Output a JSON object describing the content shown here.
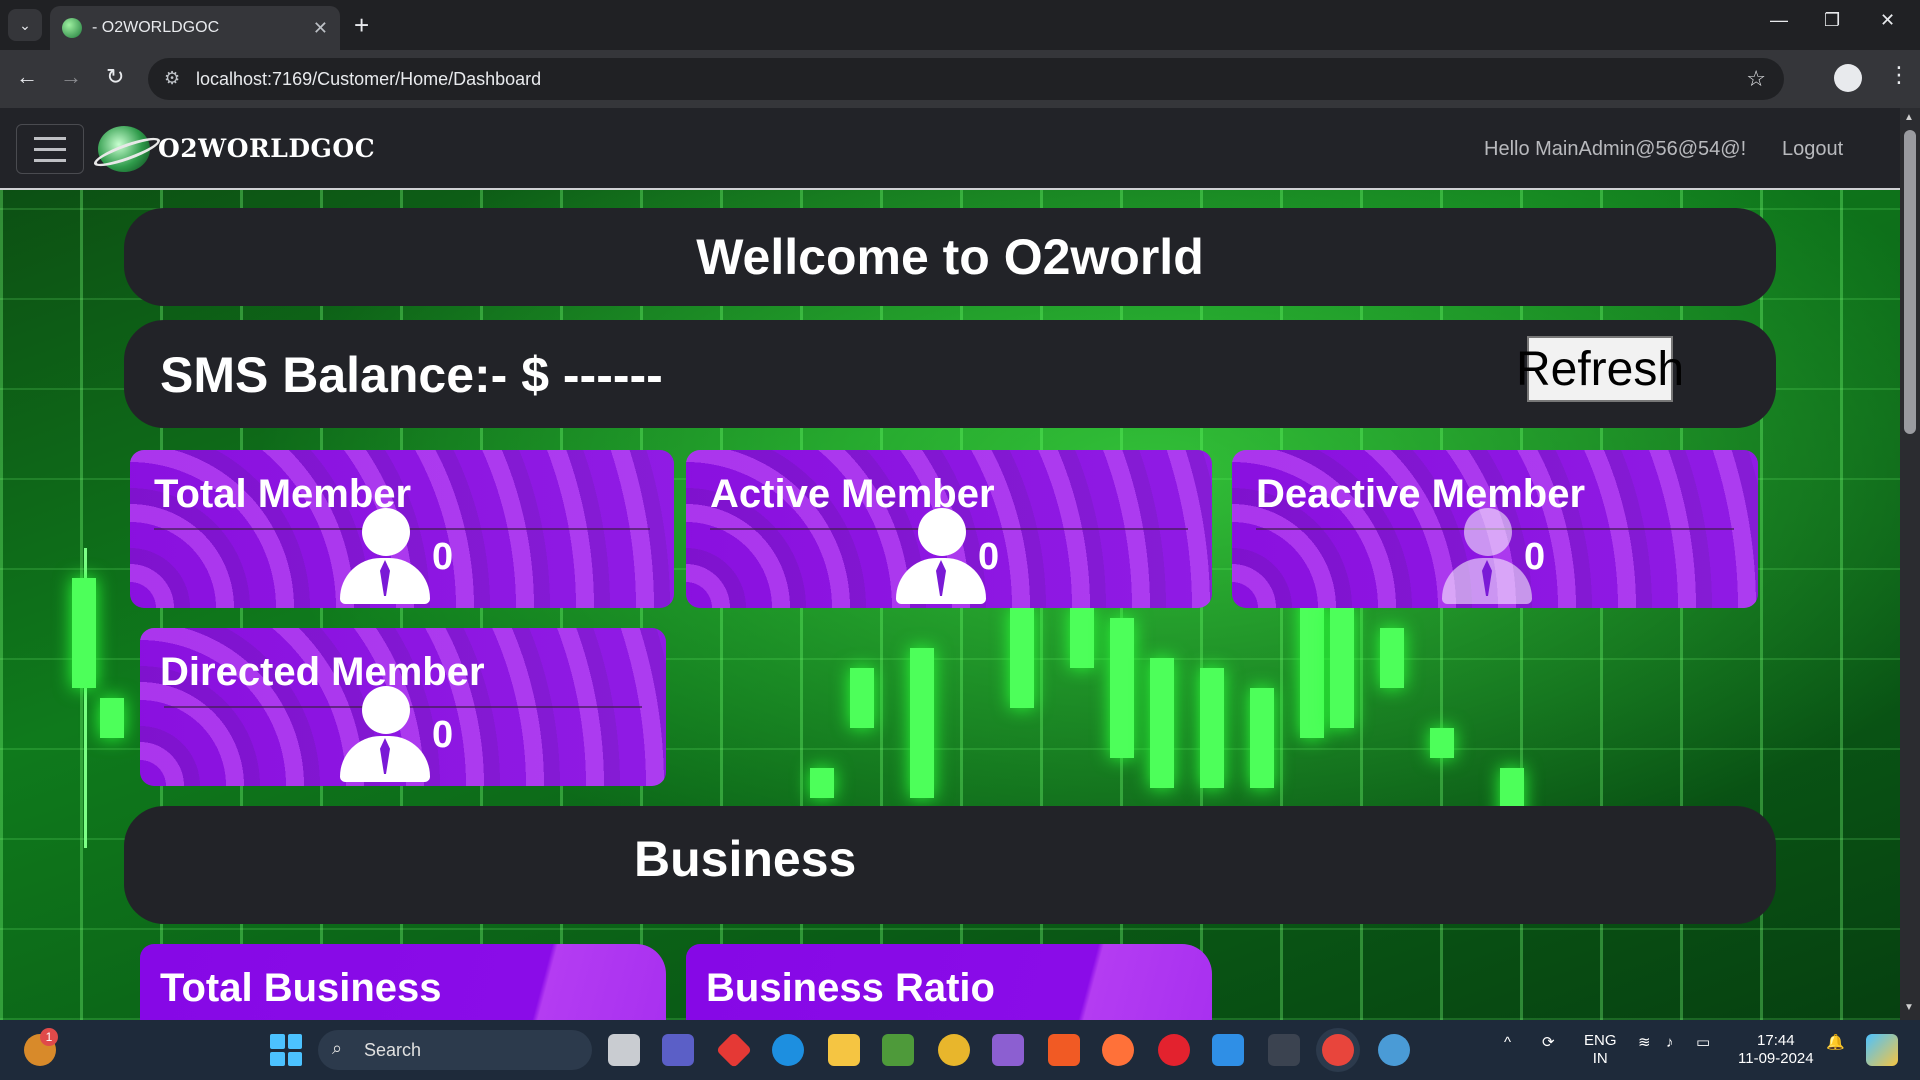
{
  "browser": {
    "tab_title": "- O2WORLDGOC",
    "url": "localhost:7169/Customer/Home/Dashboard"
  },
  "navbar": {
    "brand": "O2WORLDGOC",
    "hello": "Hello MainAdmin@56@54@!",
    "logout": "Logout"
  },
  "welcome": "Wellcome to O2world",
  "sms": {
    "label": "SMS Balance:- $ ------",
    "refresh": "Refresh"
  },
  "members": [
    {
      "title": "Total Member",
      "count": "0"
    },
    {
      "title": "Active Member",
      "count": "0"
    },
    {
      "title": "Deactive Member",
      "count": "0"
    },
    {
      "title": "Directed Member",
      "count": "0"
    }
  ],
  "business": {
    "title": "Business",
    "cards": [
      {
        "title": "Total Business"
      },
      {
        "title": "Business Ratio"
      }
    ]
  },
  "taskbar": {
    "search": "Search",
    "lang1": "ENG",
    "lang2": "IN",
    "time": "17:44",
    "date": "11-09-2024",
    "notification_badge": "1"
  }
}
